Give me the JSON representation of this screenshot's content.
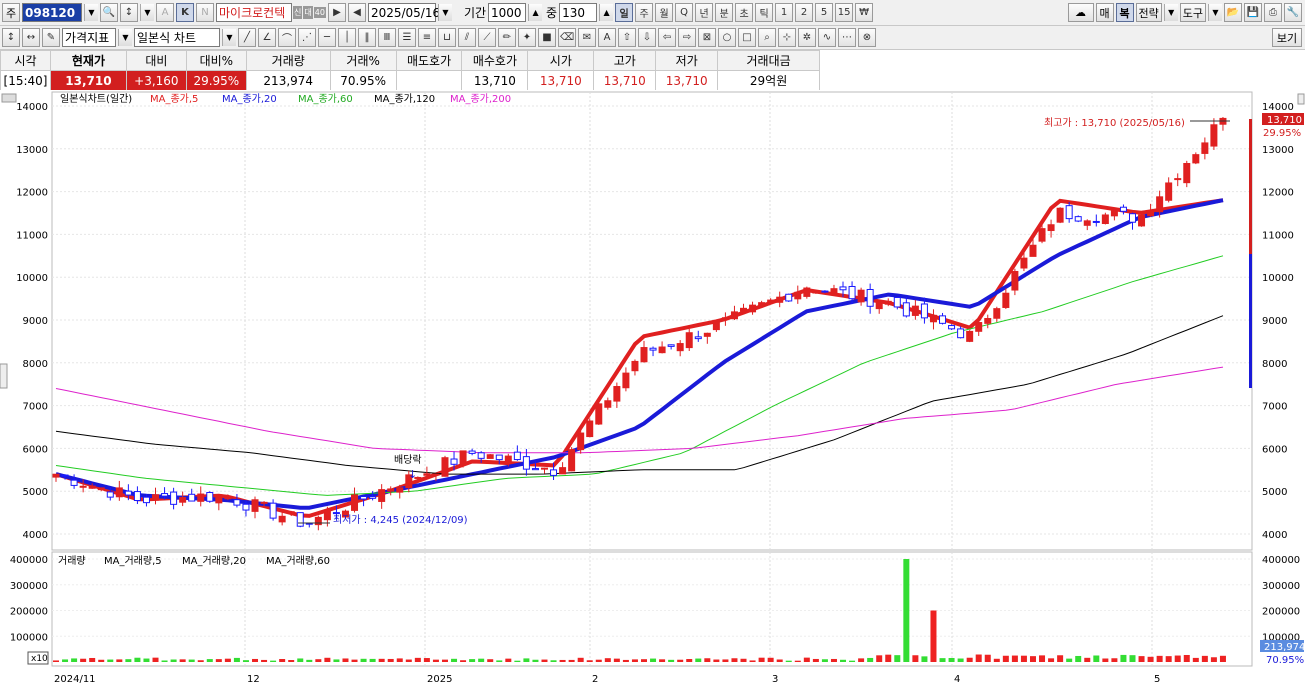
{
  "toolbar": {
    "market": "주",
    "code": "098120",
    "stock_name": "마이크로컨텍",
    "badges": [
      "신",
      "대",
      "40"
    ],
    "date": "2025/05/16",
    "period_label": "기간",
    "period_value": "1000",
    "count_label": "중",
    "count_value": "130",
    "intervals": [
      "일",
      "주",
      "월",
      "Q",
      "년",
      "분",
      "초",
      "틱",
      "1",
      "2",
      "5",
      "15"
    ],
    "active_interval": "일",
    "right_buttons": [
      "매",
      "복",
      "전략",
      "도구"
    ],
    "view_button": "보기",
    "indicator_select": "가격지표",
    "chart_type_select": "일본식 차트",
    "mode_k": "K",
    "mode_n": "N",
    "mode_a": "A"
  },
  "quote": {
    "headers": [
      "시각",
      "현재가",
      "대비",
      "대비%",
      "거래량",
      "거래%",
      "매도호가",
      "매수호가",
      "시가",
      "고가",
      "저가",
      "거래대금"
    ],
    "values": [
      "[15:40]",
      "13,710",
      "+3,160",
      "29.95%",
      "213,974",
      "70.95%",
      "",
      "13,710",
      "13,710",
      "13,710",
      "13,710",
      "29억원"
    ]
  },
  "chart": {
    "legend_price": [
      "일본식차트(일간)",
      "MA_종가,5",
      "MA_종가,20",
      "MA_종가,60",
      "MA_종가,120",
      "MA_종가,200"
    ],
    "legend_volume": [
      "거래량",
      "MA_거래량,5",
      "MA_거래량,20",
      "MA_거래량,60"
    ],
    "y_ticks": [
      "14000",
      "13000",
      "12000",
      "11000",
      "10000",
      "9000",
      "8000",
      "7000",
      "6000",
      "5000",
      "4000"
    ],
    "vol_ticks": [
      "400000",
      "300000",
      "200000",
      "100000"
    ],
    "x_labels": [
      "2024/11",
      "12",
      "2025",
      "2",
      "3",
      "4",
      "5"
    ],
    "high_annotation": "최고가 : 13,710 (2025/05/16)",
    "low_annotation": "최저가 : 4,245 (2024/12/09)",
    "dividend_label": "배당락",
    "price_tag": "13,710",
    "price_pct": "29.95%",
    "vol_tag": "213,974",
    "vol_pct": "70.95%",
    "vol_scale_label": "x10",
    "colors": {
      "up": "#e02020",
      "down": "#1a1aff",
      "ma5": "#e02020",
      "ma20": "#1a1ad8",
      "ma60": "#22cc22",
      "ma120": "#000000",
      "ma200": "#dd22cc"
    }
  },
  "chart_data": {
    "type": "candlestick",
    "title": "일본식차트(일간)",
    "x_range": [
      "2024/11",
      "2025/05/16"
    ],
    "ylim": [
      3800,
      14200
    ],
    "price_path_approx": [
      {
        "date": "2024/11",
        "close": 5400
      },
      {
        "date": "2024/11 mid",
        "close": 4800
      },
      {
        "date": "2024/12",
        "close": 4900
      },
      {
        "date": "2024/12/09",
        "close": 4245
      },
      {
        "date": "2025",
        "close": 5100
      },
      {
        "date": "2025/01 end",
        "close": 5900
      },
      {
        "date": "2025/02",
        "close": 5500
      },
      {
        "date": "2025/02 end",
        "close": 8200
      },
      {
        "date": "2025/03",
        "close": 8900
      },
      {
        "date": "2025/03 end",
        "close": 9800
      },
      {
        "date": "2025/04",
        "close": 9400
      },
      {
        "date": "2025/04 mid",
        "close": 8600
      },
      {
        "date": "2025/04 end",
        "close": 11500
      },
      {
        "date": "2025/05",
        "close": 11400
      },
      {
        "date": "2025/05/16",
        "close": 13710
      }
    ],
    "series": [
      {
        "name": "MA_종가,5",
        "approx": [
          5400,
          4800,
          4900,
          4400,
          5000,
          5700,
          5600,
          8600,
          9000,
          9700,
          9400,
          8800,
          11800,
          11500,
          11800
        ]
      },
      {
        "name": "MA_종가,20",
        "approx": [
          5400,
          4900,
          4800,
          4600,
          5000,
          5400,
          5800,
          6500,
          8000,
          9200,
          9600,
          9300,
          10500,
          11400,
          11800
        ]
      },
      {
        "name": "MA_종가,60",
        "approx": [
          5600,
          5300,
          5100,
          4900,
          5000,
          5300,
          5400,
          5900,
          7000,
          8000,
          8700,
          9200,
          9900,
          10500
        ]
      },
      {
        "name": "MA_종가,120",
        "approx": [
          6400,
          6100,
          5900,
          5600,
          5400,
          5400,
          5500,
          5500,
          6200,
          7100,
          7500,
          8200,
          9100
        ]
      },
      {
        "name": "MA_종가,200",
        "approx": [
          7400,
          6900,
          6400,
          6000,
          5900,
          5900,
          6000,
          6300,
          6700,
          6900,
          7500,
          7900
        ]
      }
    ],
    "volume_peak": 400000
  }
}
